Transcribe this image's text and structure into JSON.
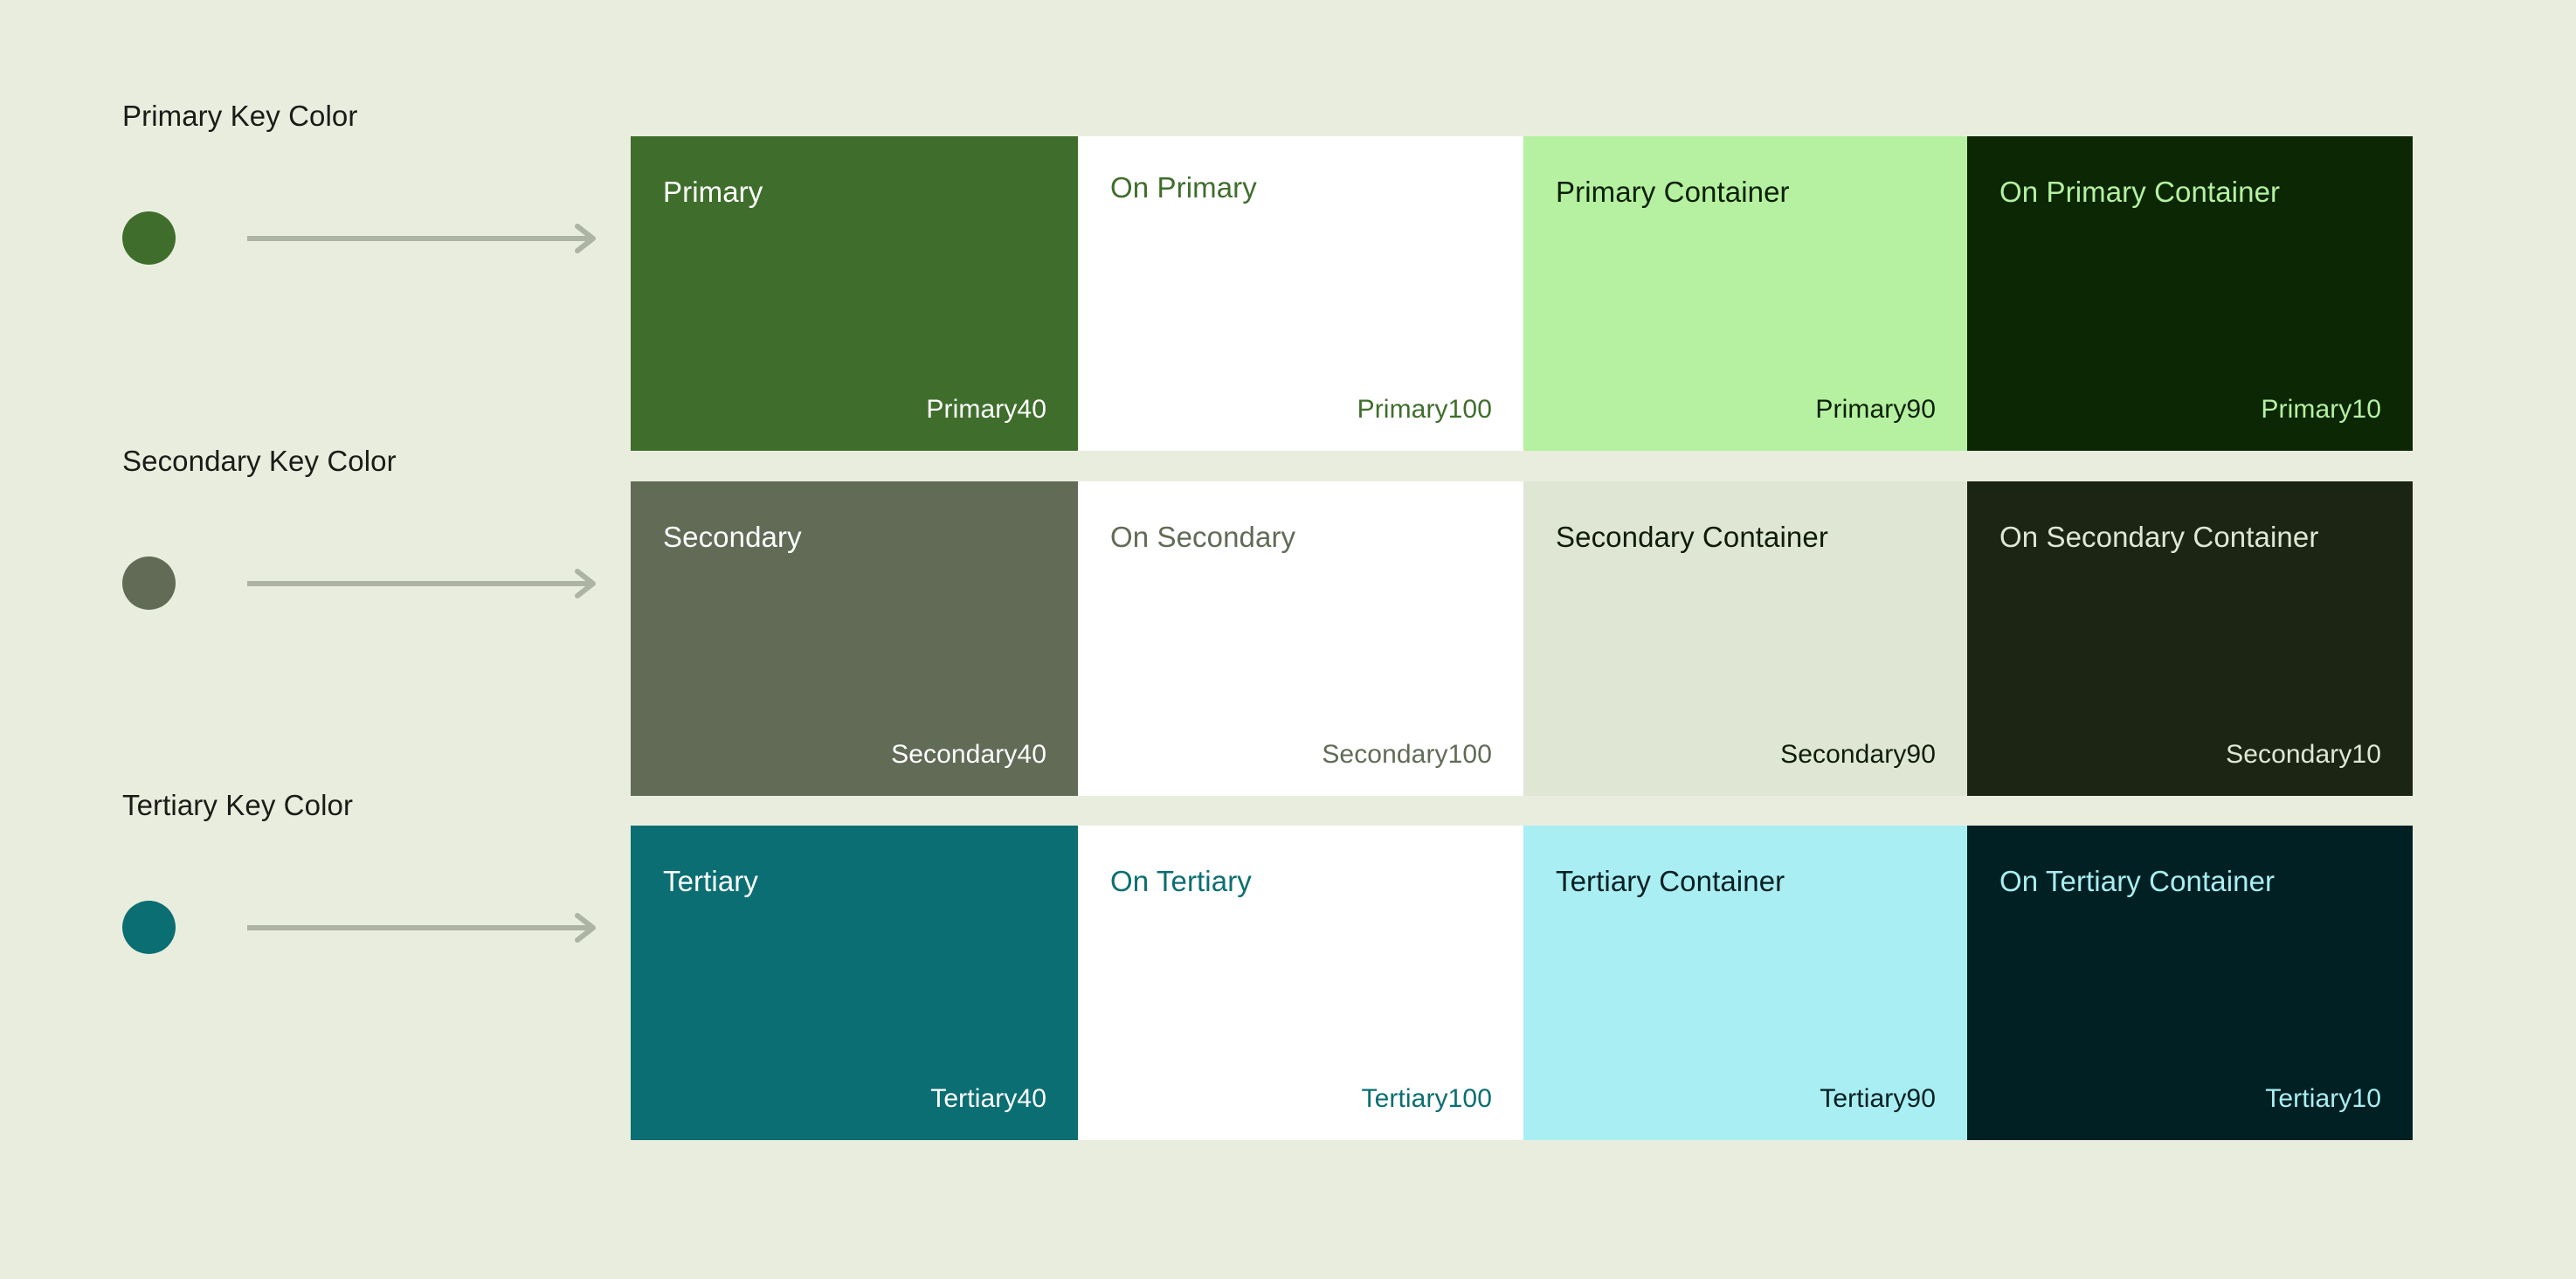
{
  "page": {
    "background": "#e9edde",
    "label_text_color": "#1b1c17",
    "arrow_color": "#aeb4a3"
  },
  "rows": [
    {
      "id": "primary",
      "key_label": "Primary Key Color",
      "key_dot_color": "#3f6e2c",
      "swatches": [
        {
          "name": "Primary",
          "token": "Primary40",
          "bg": "#3f6e2c",
          "fg": "#ffffff"
        },
        {
          "name": "On Primary",
          "token": "Primary100",
          "bg": "#ffffff",
          "fg": "#3f6e2c"
        },
        {
          "name": "Primary Container",
          "token": "Primary90",
          "bg": "#b6f0a1",
          "fg": "#0b2000"
        },
        {
          "name": "On Primary Container",
          "token": "Primary10",
          "bg": "#0b2704",
          "fg": "#b6f0a1"
        }
      ]
    },
    {
      "id": "secondary",
      "key_label": "Secondary Key Color",
      "key_dot_color": "#616b56",
      "swatches": [
        {
          "name": "Secondary",
          "token": "Secondary40",
          "bg": "#616b56",
          "fg": "#ffffff"
        },
        {
          "name": "On Secondary",
          "token": "Secondary100",
          "bg": "#ffffff",
          "fg": "#616b56"
        },
        {
          "name": "Secondary Container",
          "token": "Secondary90",
          "bg": "#dfe7d4",
          "fg": "#101c0b"
        },
        {
          "name": "On Secondary Container",
          "token": "Secondary10",
          "bg": "#1c2414",
          "fg": "#dfe7d4"
        }
      ]
    },
    {
      "id": "tertiary",
      "key_label": "Tertiary Key Color",
      "key_dot_color": "#0b6e72",
      "swatches": [
        {
          "name": "Tertiary",
          "token": "Tertiary40",
          "bg": "#0b6e72",
          "fg": "#ffffff"
        },
        {
          "name": "On Tertiary",
          "token": "Tertiary100",
          "bg": "#ffffff",
          "fg": "#0b6e72"
        },
        {
          "name": "Tertiary Container",
          "token": "Tertiary90",
          "bg": "#a9eef2",
          "fg": "#001f21"
        },
        {
          "name": "On Tertiary Container",
          "token": "Tertiary10",
          "bg": "#002023",
          "fg": "#a9eef2"
        }
      ]
    }
  ]
}
